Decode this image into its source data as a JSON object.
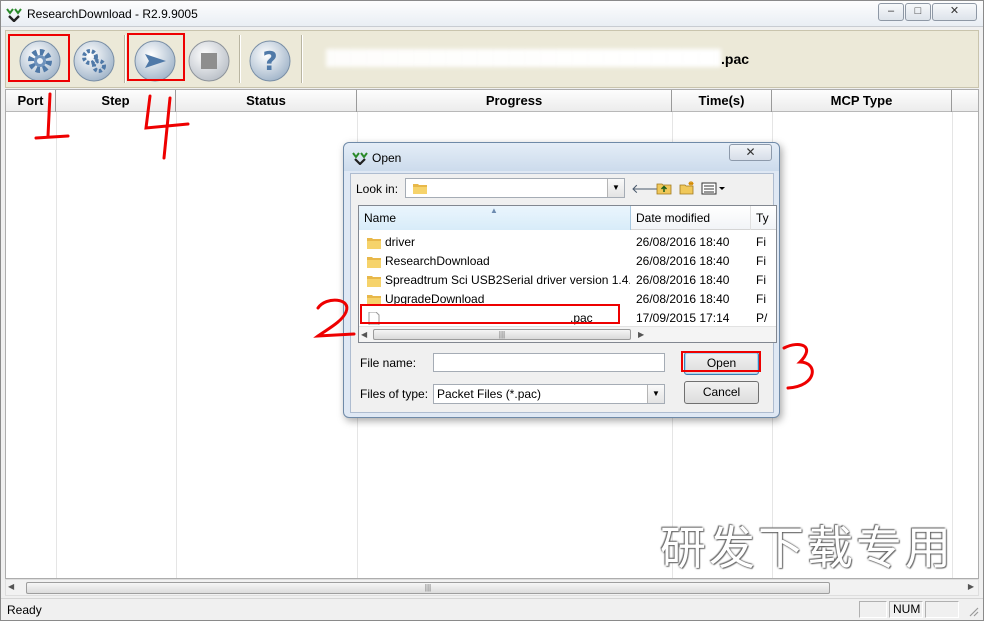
{
  "window": {
    "title": "ResearchDownload - R2.9.9005",
    "controls": {
      "minimize": "–",
      "maximize": "□",
      "close": "✕"
    }
  },
  "toolbar": {
    "buttons": [
      {
        "icon": "gear-icon",
        "tooltip": "Load packet"
      },
      {
        "icon": "gears-icon",
        "tooltip": "Settings"
      },
      {
        "icon": "play-icon",
        "tooltip": "Start downloading"
      },
      {
        "icon": "stop-icon",
        "tooltip": "Stop downloading"
      },
      {
        "icon": "help-icon",
        "tooltip": "About"
      }
    ],
    "packet_suffix": ".pac"
  },
  "grid": {
    "columns": [
      "Port",
      "Step",
      "Status",
      "Progress",
      "Time(s)",
      "MCP Type"
    ]
  },
  "statusbar": {
    "text": "Ready",
    "num": "NUM"
  },
  "dialog": {
    "title": "Open",
    "close": "✕",
    "look_in_label": "Look in:",
    "columns": {
      "name": "Name",
      "date": "Date modified",
      "type": "Ty"
    },
    "files": [
      {
        "name": "driver",
        "date": "26/08/2016 18:40",
        "type": "Fi",
        "icon": "folder-icon"
      },
      {
        "name": "ResearchDownload",
        "date": "26/08/2016 18:40",
        "type": "Fi",
        "icon": "folder-icon"
      },
      {
        "name": "Spreadtrum Sci USB2Serial driver version 1.4....",
        "date": "26/08/2016 18:40",
        "type": "Fi",
        "icon": "folder-icon"
      },
      {
        "name": "UpgradeDownload",
        "date": "26/08/2016 18:40",
        "type": "Fi",
        "icon": "folder-icon"
      },
      {
        "name": ".pac",
        "date": "17/09/2015 17:14",
        "type": "P/",
        "icon": "file-icon"
      }
    ],
    "file_name_label": "File name:",
    "file_name_value": "",
    "files_of_type_label": "Files of type:",
    "files_of_type_value": "Packet Files (*.pac)",
    "open_button": "Open",
    "cancel_button": "Cancel"
  },
  "watermark": "研发下载专用",
  "annotation_color": "#e00000"
}
